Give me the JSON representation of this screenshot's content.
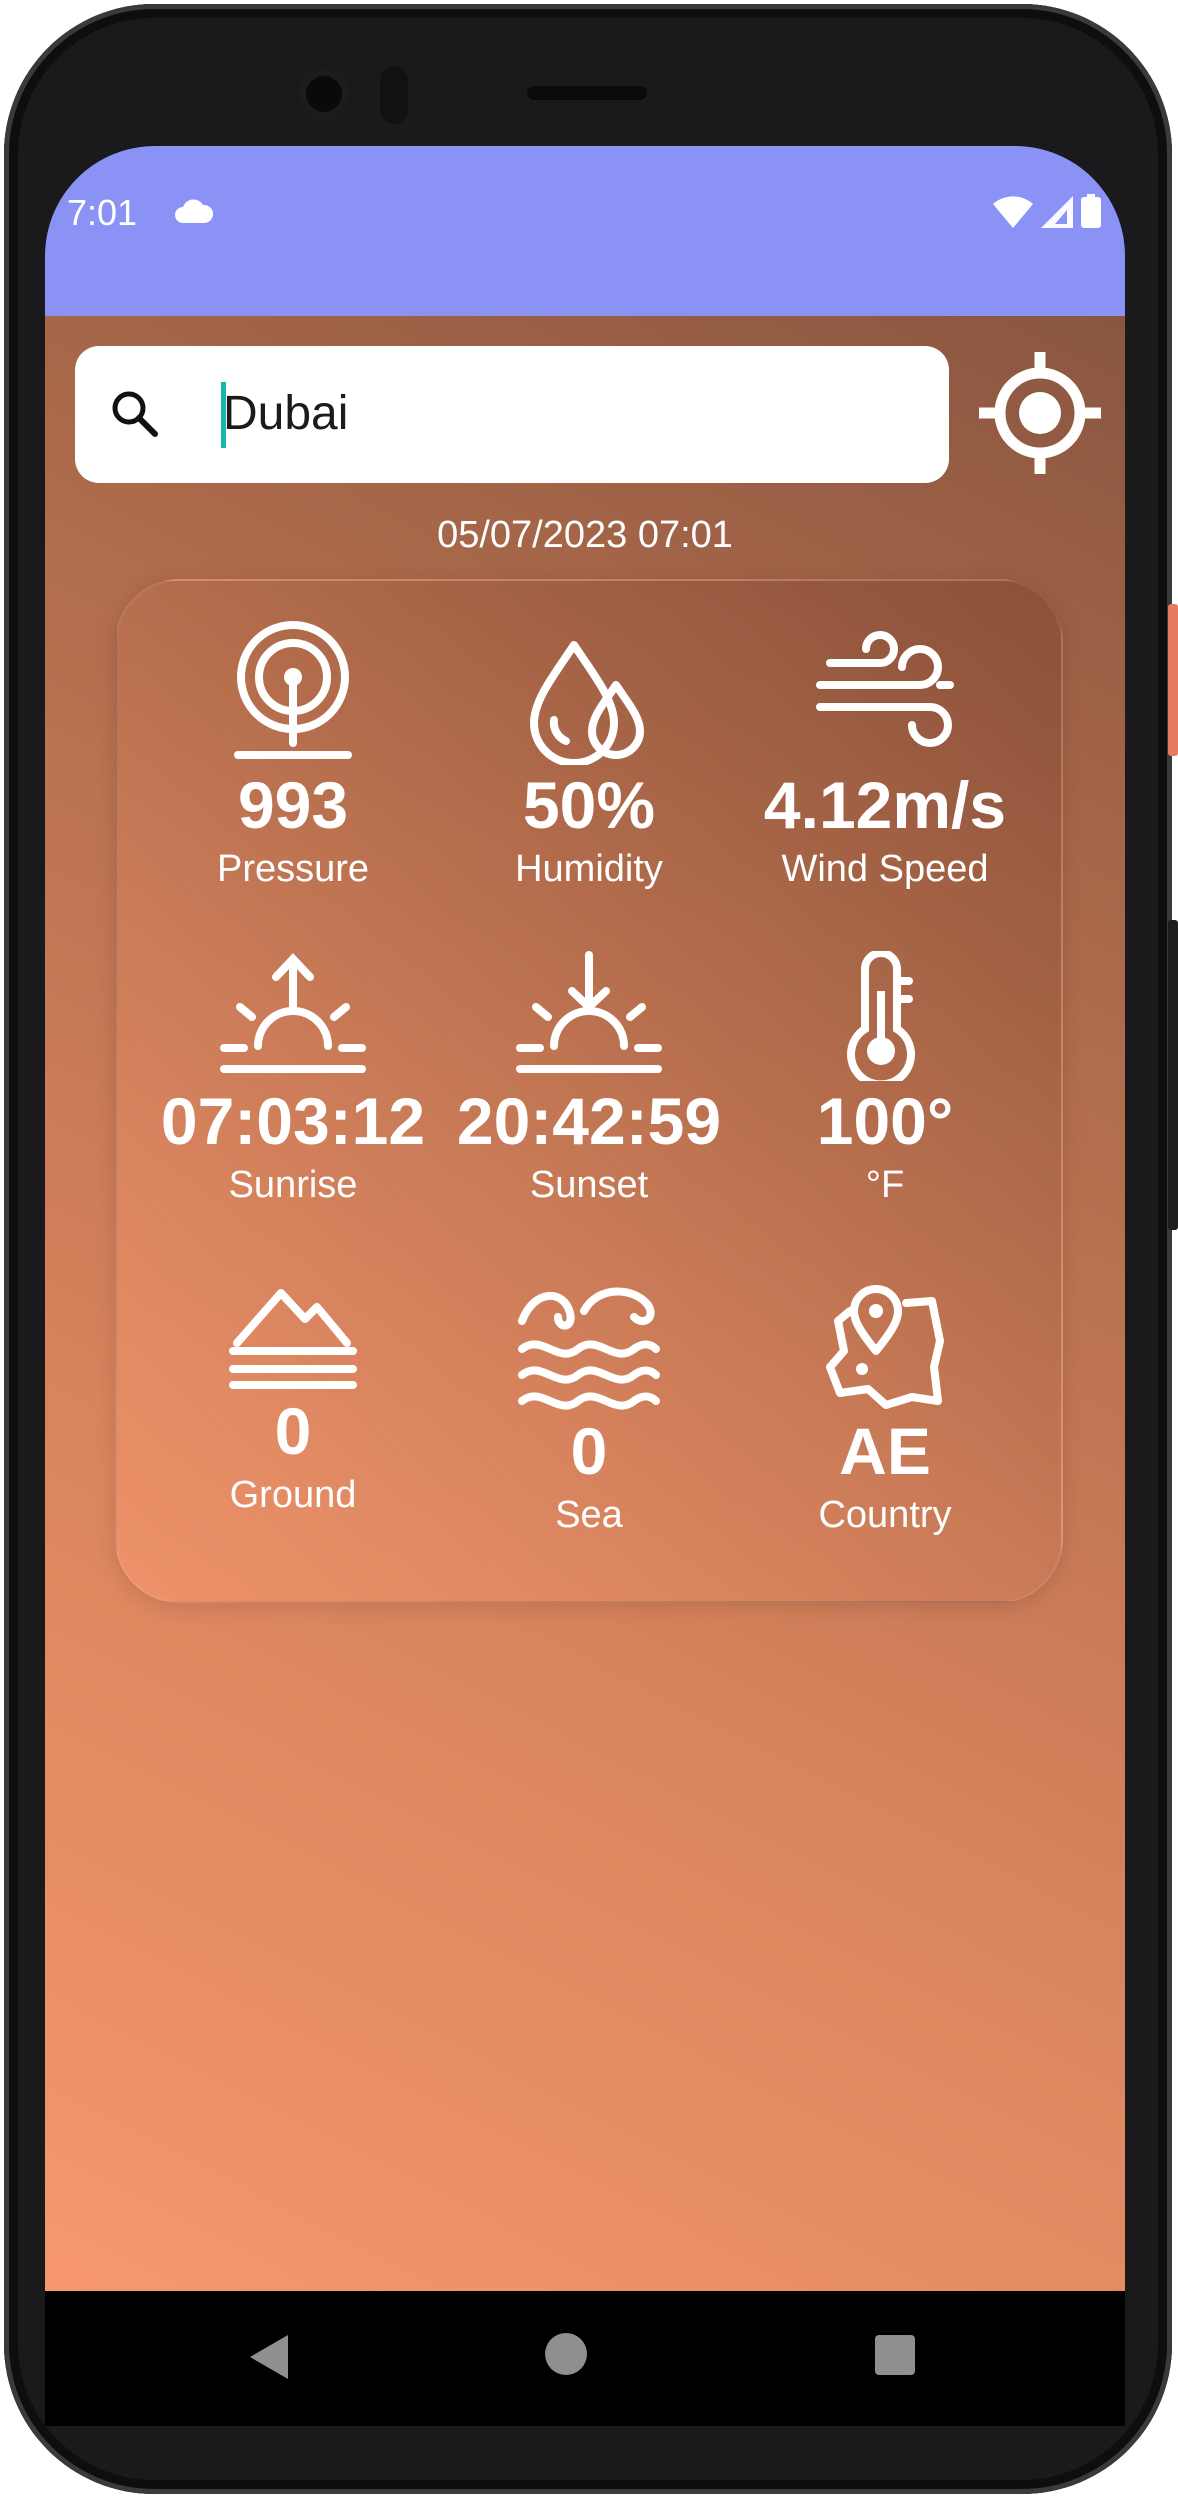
{
  "status_bar": {
    "time": "7:01",
    "icons": [
      "cloud-icon",
      "wifi-icon",
      "signal-icon",
      "battery-icon"
    ]
  },
  "search": {
    "value": "Dubai",
    "icon": "search-icon"
  },
  "locate_icon": "location-target-icon",
  "datetime": "05/07/2023 07:01",
  "weather": [
    {
      "icon": "pressure-icon",
      "value": "993",
      "label": "Pressure"
    },
    {
      "icon": "humidity-icon",
      "value": "50%",
      "label": "Humidity"
    },
    {
      "icon": "wind-icon",
      "value": "4.12m/s",
      "label": "Wind Speed"
    },
    {
      "icon": "sunrise-icon",
      "value": "07:03:12",
      "label": "Sunrise"
    },
    {
      "icon": "sunset-icon",
      "value": "20:42:59",
      "label": "Sunset"
    },
    {
      "icon": "thermometer-icon",
      "value": "100°",
      "label": "°F"
    },
    {
      "icon": "mountain-icon",
      "value": "0",
      "label": "Ground"
    },
    {
      "icon": "sea-waves-icon",
      "value": "0",
      "label": "Sea"
    },
    {
      "icon": "country-map-icon",
      "value": "AE",
      "label": "Country"
    }
  ],
  "nav": {
    "icons": [
      "back-icon",
      "home-icon",
      "recents-icon"
    ]
  },
  "colors": {
    "status_bar": "#8a92f5",
    "gradient_light": "#f6976f",
    "gradient_dark": "#8a5640",
    "caret": "#19b6b0"
  }
}
